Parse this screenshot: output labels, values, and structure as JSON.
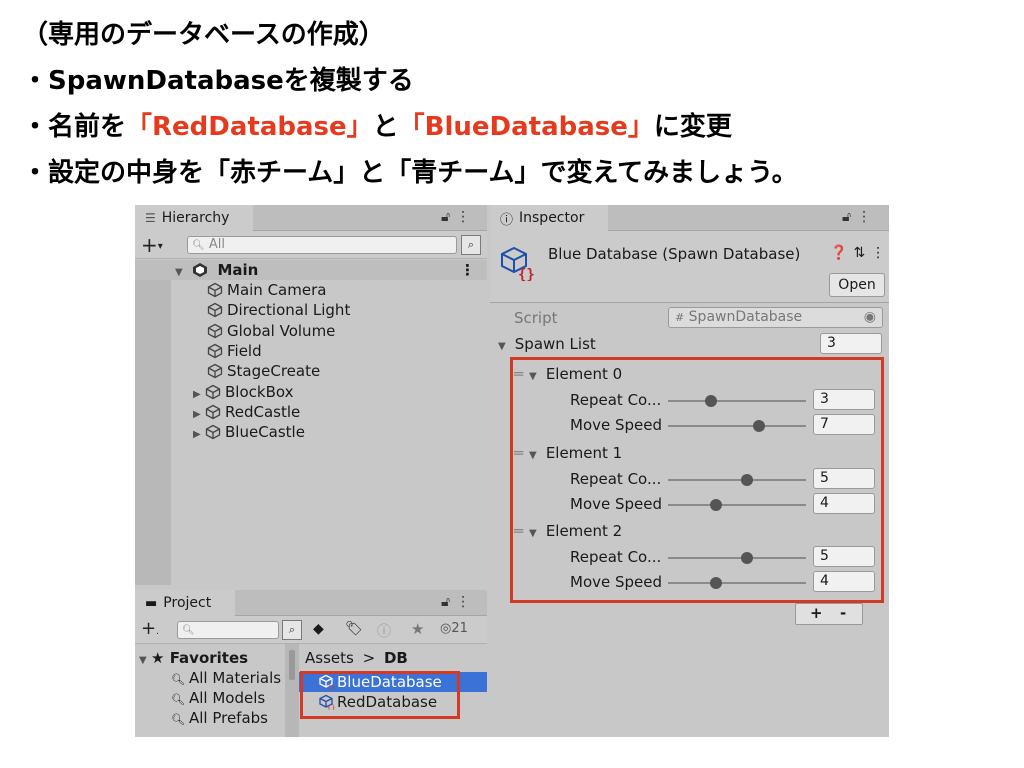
{
  "slide": {
    "line1": "（専用のデータベースの作成）",
    "line2": "・SpawnDatabaseを複製する",
    "line3_a": "・名前を",
    "line3_b": "「RedDatabase」",
    "line3_c": "と",
    "line3_d": "「BlueDatabase」",
    "line3_e": "に変更",
    "line4": "・設定の中身を「赤チーム」と「青チーム」で変えてみましょう。",
    "accent_color": "#e53a1e"
  },
  "hierarchy": {
    "tab_label": "Hierarchy",
    "search_placeholder": "All",
    "scene": "Main",
    "items": [
      {
        "label": "Main Camera",
        "expandable": false
      },
      {
        "label": "Directional Light",
        "expandable": false
      },
      {
        "label": "Global Volume",
        "expandable": false
      },
      {
        "label": "Field",
        "expandable": false
      },
      {
        "label": "StageCreate",
        "expandable": false
      },
      {
        "label": "BlockBox",
        "expandable": true
      },
      {
        "label": "RedCastle",
        "expandable": true
      },
      {
        "label": "BlueCastle",
        "expandable": true
      }
    ]
  },
  "project": {
    "tab_label": "Project",
    "hidden_count": "21",
    "favorites_label": "Favorites",
    "favorites": [
      "All Materials",
      "All Models",
      "All Prefabs"
    ],
    "breadcrumb_root": "Assets",
    "breadcrumb_sep": ">",
    "breadcrumb_folder": "DB",
    "assets": [
      {
        "label": "BlueDatabase",
        "selected": true
      },
      {
        "label": "RedDatabase",
        "selected": false
      }
    ]
  },
  "inspector": {
    "tab_label": "Inspector",
    "object_title": "Blue Database (Spawn Database)",
    "open_label": "Open",
    "script_label": "Script",
    "script_value": "SpawnDatabase",
    "spawn_list_label": "Spawn List",
    "spawn_list_size": "3",
    "elements": [
      {
        "name": "Element 0",
        "repeat_label": "Repeat Co...",
        "repeat_value": "3",
        "repeat_fraction": 0.31,
        "speed_label": "Move Speed",
        "speed_value": "7",
        "speed_fraction": 0.66
      },
      {
        "name": "Element 1",
        "repeat_label": "Repeat Co...",
        "repeat_value": "5",
        "repeat_fraction": 0.57,
        "speed_label": "Move Speed",
        "speed_value": "4",
        "speed_fraction": 0.35
      },
      {
        "name": "Element 2",
        "repeat_label": "Repeat Co...",
        "repeat_value": "5",
        "repeat_fraction": 0.57,
        "speed_label": "Move Speed",
        "speed_value": "4",
        "speed_fraction": 0.35
      }
    ],
    "add_label": "+",
    "remove_label": "-"
  }
}
